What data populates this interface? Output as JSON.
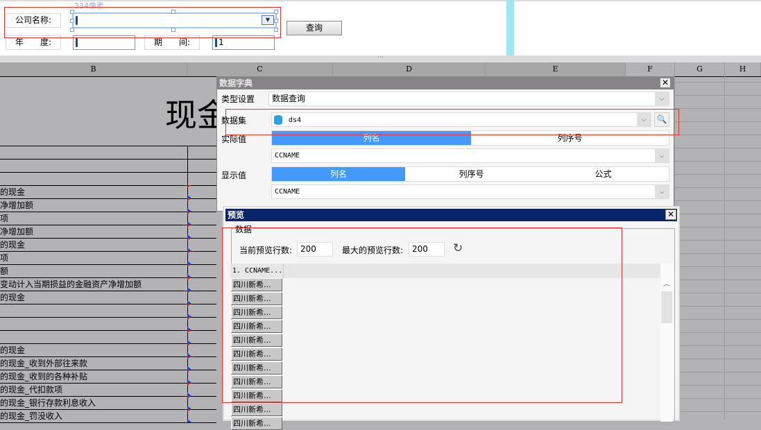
{
  "form": {
    "company_label": "公司名称:",
    "width_hint": "334像素",
    "year_label": "年　　度:",
    "period_label": "期　　间:",
    "period_value": "1",
    "query_button": "查询"
  },
  "sheet": {
    "columns": [
      "B",
      "C",
      "D",
      "E",
      "F",
      "G",
      "H"
    ],
    "title": "现金",
    "rows": [
      "的现金",
      "净增加额",
      "项",
      "净增加额",
      "的现金",
      "项",
      "额",
      "变动计入当期损益的金融资产净增加额",
      "的现金",
      "",
      "",
      "",
      "的现金",
      "的现金_收到外部往来款",
      "的现金_收到的各种补贴",
      "的现金_代扣款项",
      "的现金_银行存款利息收入",
      "的现金_罚没收入"
    ]
  },
  "dict_dialog": {
    "title": "数据字典",
    "type_label": "类型设置",
    "type_value": "数据查询",
    "dataset_label": "数据集",
    "dataset_value": "ds4",
    "actual_label": "实际值",
    "actual_tabs": [
      "列名",
      "列序号"
    ],
    "actual_value": "CCNAME",
    "display_label": "显示值",
    "display_tabs": [
      "列名",
      "列序号",
      "公式"
    ],
    "display_value": "CCNAME"
  },
  "preview_dialog": {
    "title": "预览",
    "group_label": "数据",
    "current_rows_label": "当前预览行数:",
    "current_rows": "200",
    "max_rows_label": "最大的预览行数:",
    "max_rows": "200",
    "column_header": "1. CCNAME...",
    "rows": [
      "四川新希...",
      "四川新希...",
      "四川新希...",
      "四川新希...",
      "四川新希...",
      "四川新希...",
      "四川新希...",
      "四川新希...",
      "四川新希...",
      "四川新希...",
      "四川新希..."
    ]
  }
}
